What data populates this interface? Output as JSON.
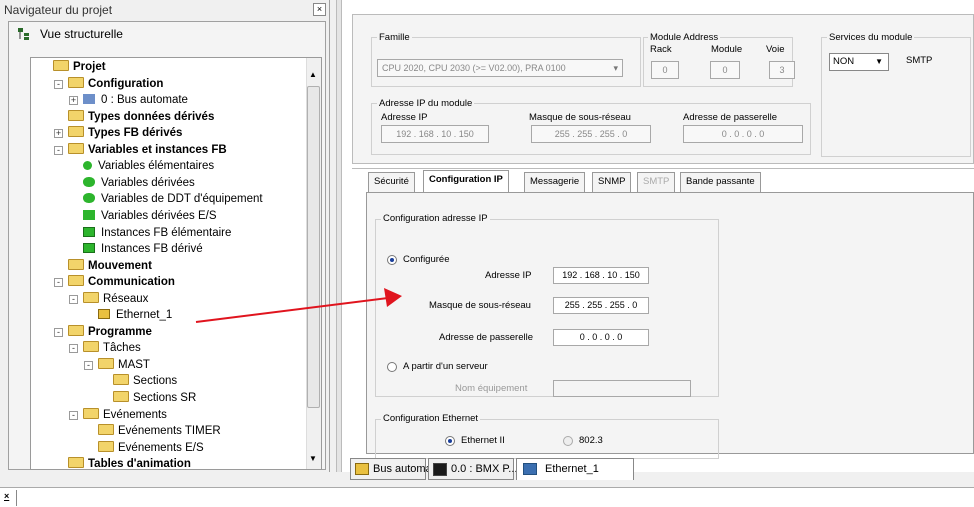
{
  "navigator": {
    "title": "Navigateur du projet",
    "view_label": "Vue structurelle",
    "tree": [
      {
        "label": "Projet",
        "bold": true
      },
      {
        "label": "Configuration",
        "bold": true
      },
      {
        "label": "0 : Bus automate",
        "bold": false
      },
      {
        "label": "Types données dérivés",
        "bold": true
      },
      {
        "label": "Types FB dérivés",
        "bold": true
      },
      {
        "label": "Variables et instances FB",
        "bold": true
      },
      {
        "label": "Variables élémentaires",
        "bold": false
      },
      {
        "label": "Variables dérivées",
        "bold": false
      },
      {
        "label": "Variables de DDT d'équipement",
        "bold": false
      },
      {
        "label": "Variables dérivées E/S",
        "bold": false
      },
      {
        "label": "Instances FB élémentaire",
        "bold": false
      },
      {
        "label": "Instances FB dérivé",
        "bold": false
      },
      {
        "label": "Mouvement",
        "bold": true
      },
      {
        "label": "Communication",
        "bold": true
      },
      {
        "label": "Réseaux",
        "bold": false
      },
      {
        "label": "Ethernet_1",
        "bold": false
      },
      {
        "label": "Programme",
        "bold": true
      },
      {
        "label": "Tâches",
        "bold": false
      },
      {
        "label": "MAST",
        "bold": false
      },
      {
        "label": "Sections",
        "bold": false
      },
      {
        "label": "Sections SR",
        "bold": false
      },
      {
        "label": "Evénements",
        "bold": false
      },
      {
        "label": "Evénements TIMER",
        "bold": false
      },
      {
        "label": "Evénements E/S",
        "bold": false
      },
      {
        "label": "Tables d'animation",
        "bold": true
      }
    ]
  },
  "module": {
    "famille_label": "Famille",
    "famille_value": "CPU 2020, CPU 2030 (>= V02.00), PRA 0100",
    "module_address_label": "Module Address",
    "rack_label": "Rack",
    "module_label": "Module",
    "voie_label": "Voie",
    "rack_value": "0",
    "module_value": "0",
    "voie_value": "3",
    "services_label": "Services du module",
    "services_value": "NON",
    "services_option": "SMTP",
    "ip_group_label": "Adresse IP du module",
    "ip_label": "Adresse IP",
    "ip_value": "192 . 168 . 10 . 150",
    "mask_label": "Masque de sous-réseau",
    "mask_value": "255 . 255 . 255 . 0",
    "gw_label": "Adresse de passerelle",
    "gw_value": "0 . 0 . 0 . 0"
  },
  "tabs": [
    "Sécurité",
    "Configuration IP",
    "Messagerie",
    "SNMP",
    "SMTP",
    "Bande passante"
  ],
  "config_ip": {
    "group_label": "Configuration adresse IP",
    "configured_label": "Configurée",
    "ip_label": "Adresse IP",
    "ip_value": "192 . 168 . 10 . 150",
    "mask_label": "Masque de sous-réseau",
    "mask_value": "255 . 255 . 255 . 0",
    "gw_label": "Adresse de passerelle",
    "gw_value": "0 . 0 . 0 . 0",
    "server_label": "A partir d'un serveur",
    "device_name_label": "Nom équipement",
    "device_name_value": "",
    "eth_group_label": "Configuration Ethernet",
    "eth2_label": "Ethernet II",
    "eth8023_label": "802.3"
  },
  "bottom_tabs": [
    "Bus automate",
    "0.0 : BMX P...",
    "Ethernet_1"
  ],
  "colors": {
    "arrow": "#e0141e",
    "accent": "#1a3f9a"
  }
}
